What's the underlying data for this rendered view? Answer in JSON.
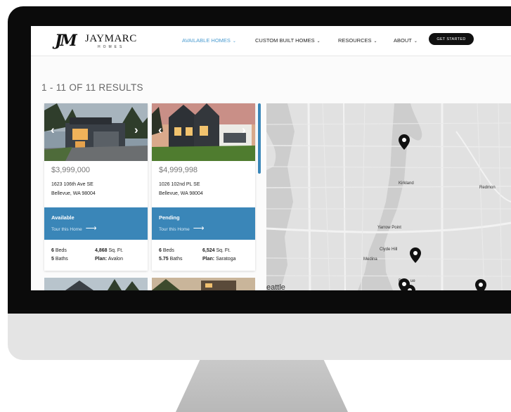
{
  "nav": {
    "logo_mark": "JM",
    "logo_word": "JAYMARC",
    "logo_sub": "HOMES",
    "items": [
      {
        "label": "AVAILABLE HOMES",
        "active": true
      },
      {
        "label": "CUSTOM BUILT HOMES",
        "active": false
      },
      {
        "label": "RESOURCES",
        "active": false
      },
      {
        "label": "ABOUT",
        "active": false
      }
    ],
    "cta": "GET STARTED",
    "caret": "⌄"
  },
  "results_label": "1 - 11 OF 11 RESULTS",
  "listings": [
    {
      "price": "$3,999,000",
      "address_line1": "1623 106th Ave SE",
      "address_line2": "Bellevue, WA 98004",
      "status": "Available",
      "tour_label": "Tour this Home",
      "beds": "6",
      "beds_label": "Beds",
      "baths": "5",
      "baths_label": "Baths",
      "sqft": "4,868",
      "sqft_label": "Sq. Ft.",
      "plan_label": "Plan:",
      "plan": "Avalon"
    },
    {
      "price": "$4,999,998",
      "address_line1": "1026 102nd PL SE",
      "address_line2": "Bellevue, WA 98004",
      "status": "Pending",
      "tour_label": "Tour this Home",
      "beds": "6",
      "beds_label": "Beds",
      "baths": "5.75",
      "baths_label": "Baths",
      "sqft": "6,524",
      "sqft_label": "Sq. Ft.",
      "plan_label": "Plan:",
      "plan": "Saratoga"
    }
  ],
  "map": {
    "labels": [
      "Kirkland",
      "Redmon",
      "Yarrow Point",
      "Clyde Hill",
      "Medina",
      "Be",
      "ue",
      "eattle"
    ]
  },
  "colors": {
    "accent": "#3a86b8",
    "nav_active": "#4a9bd0"
  },
  "icons": {
    "prev": "‹",
    "next": "›",
    "tour_arrow": "⟶"
  }
}
